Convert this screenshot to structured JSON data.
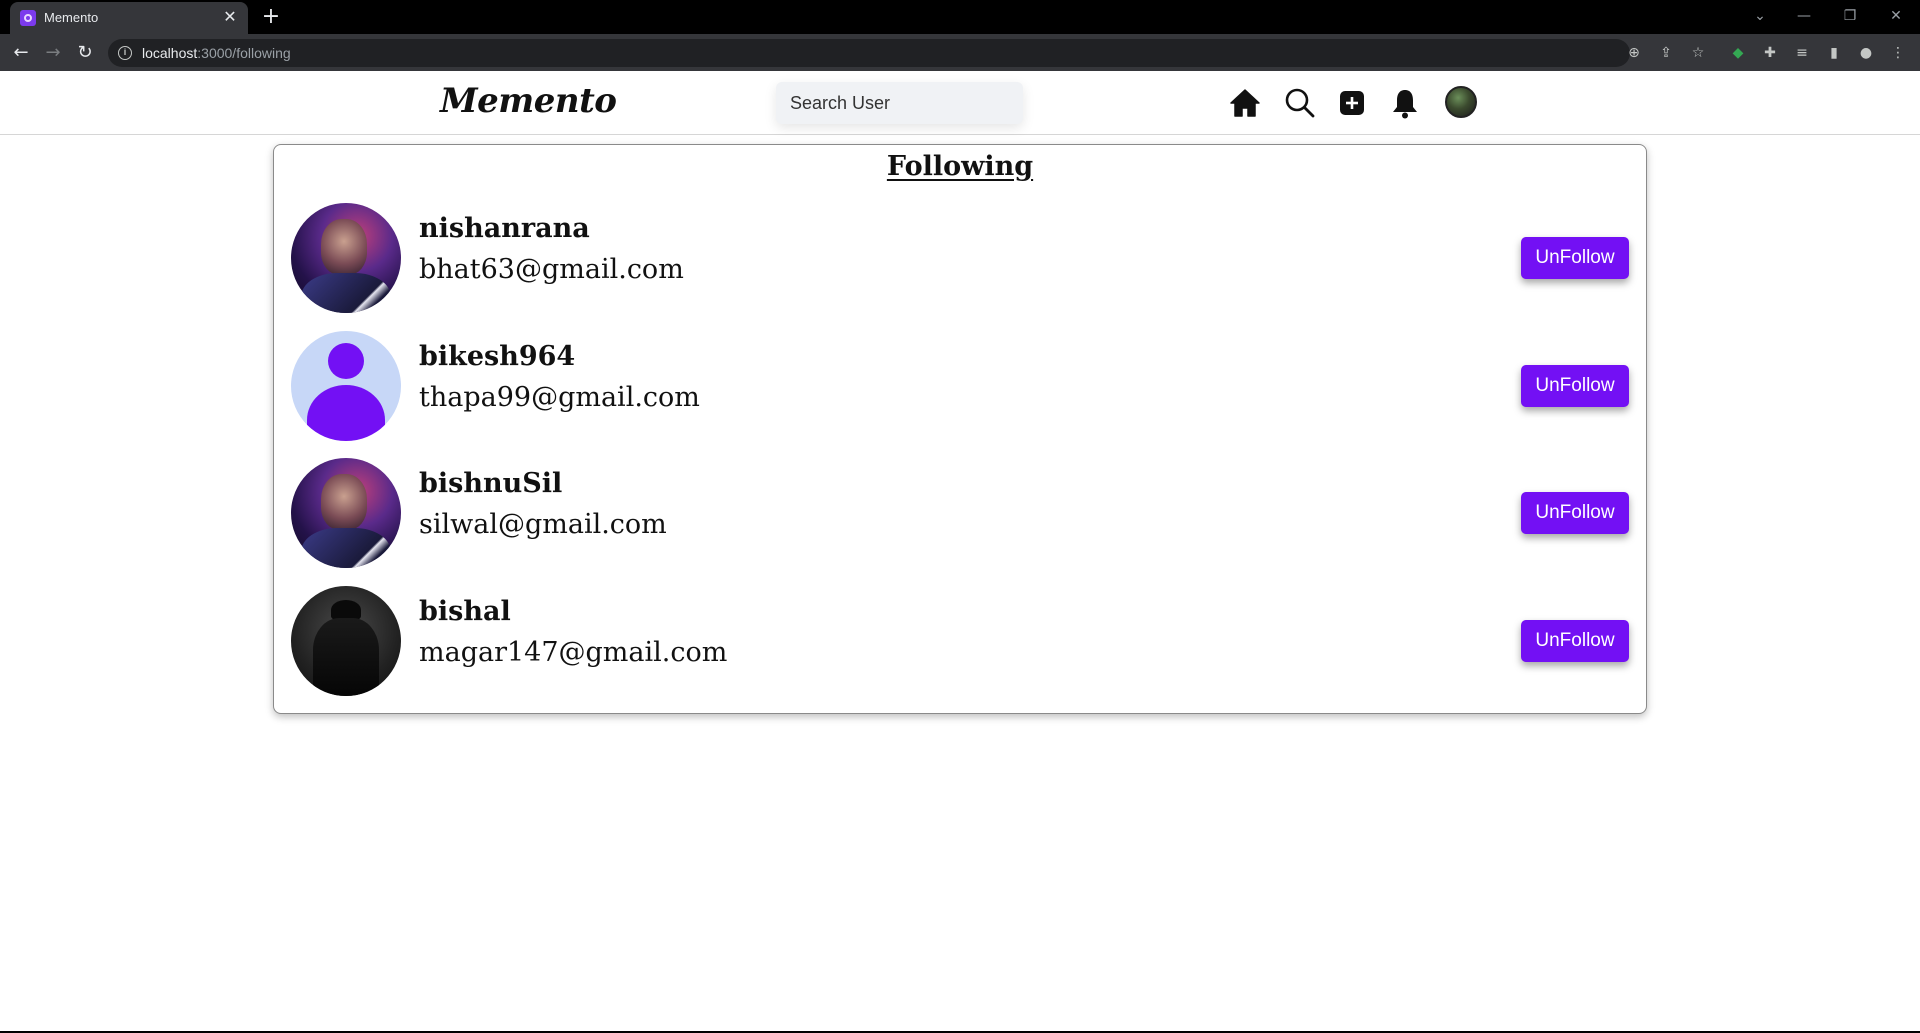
{
  "browser": {
    "tab_title": "Memento",
    "tab_close": "✕",
    "new_tab": "+",
    "url_host": "localhost",
    "url_path": ":3000/following",
    "controls": {
      "minimize": "—",
      "restore": "❐",
      "close": "✕",
      "dropdown": "⌄"
    }
  },
  "header": {
    "logo": "Memento",
    "search_placeholder": "Search User"
  },
  "following": {
    "title": "Following",
    "users": [
      {
        "username": "nishanrana",
        "email": "bhat63@gmail.com",
        "button": "UnFollow"
      },
      {
        "username": "bikesh964",
        "email": "thapa99@gmail.com",
        "button": "UnFollow"
      },
      {
        "username": "bishnuSil",
        "email": "silwal@gmail.com",
        "button": "UnFollow"
      },
      {
        "username": "bishal",
        "email": "magar147@gmail.com",
        "button": "UnFollow"
      }
    ]
  },
  "colors": {
    "accent": "#7310f4",
    "default_avatar_bg": "#c7d7f7",
    "search_bg": "#f0f2f5"
  },
  "icons": [
    "home-icon",
    "search-icon",
    "add-post-icon",
    "bell-icon",
    "profile-avatar"
  ]
}
